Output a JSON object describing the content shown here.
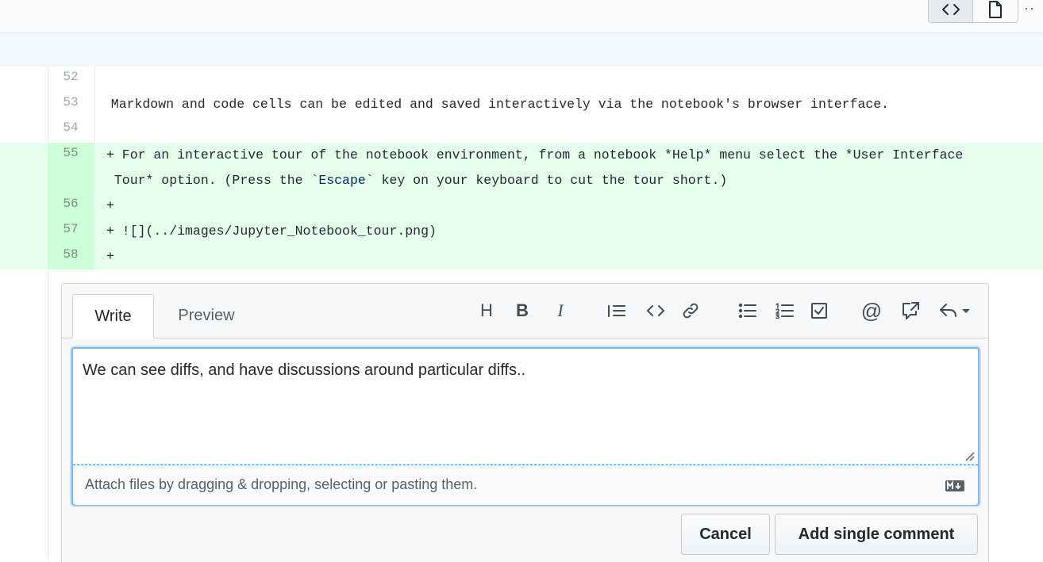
{
  "toolbar": {
    "code_view_icon": "code-icon",
    "file_view_icon": "file-icon",
    "more_label": "··"
  },
  "diff": {
    "lines": [
      {
        "number": "52",
        "text": "",
        "added": false
      },
      {
        "number": "53",
        "text": "  Markdown and code cells can be edited and saved interactively via the notebook's browser interface.",
        "added": false
      },
      {
        "number": "54",
        "text": "",
        "added": false
      },
      {
        "number": "55",
        "text_a": "+ For an interactive tour of the notebook environment, from a notebook *Help* menu select the *User Interface",
        "text_b_pre": " Tour* option. (Press the ",
        "text_b_code": "`Escape`",
        "text_b_post": " key on your keyboard to cut the tour short.)",
        "added": true
      },
      {
        "number": "56",
        "text": "+",
        "added": true
      },
      {
        "number": "57",
        "text": "+ ![](../images/Jupyter_Notebook_tour.png)",
        "added": true
      },
      {
        "number": "58",
        "text": "+",
        "added": true
      }
    ]
  },
  "comment_form": {
    "tabs": [
      {
        "label": "Write",
        "active": true
      },
      {
        "label": "Preview",
        "active": false
      }
    ],
    "tools": [
      "heading",
      "bold",
      "italic",
      "quote",
      "code",
      "link",
      "unordered-list",
      "ordered-list",
      "task-list",
      "mention",
      "reference",
      "reply"
    ],
    "heading_glyph": "H",
    "bold_glyph": "B",
    "italic_glyph": "I",
    "mention_glyph": "@",
    "textarea_value": "We can see diffs, and have discussions around particular diffs..",
    "attach_hint": "Attach files by dragging & dropping, selecting or pasting them.",
    "cancel_label": "Cancel",
    "submit_label": "Add single comment"
  },
  "colors": {
    "added_bg": "#e6ffed",
    "added_gutter": "#cdffd8",
    "hunk_bg": "#f1f8ff",
    "focus_border": "#79b8ff"
  }
}
